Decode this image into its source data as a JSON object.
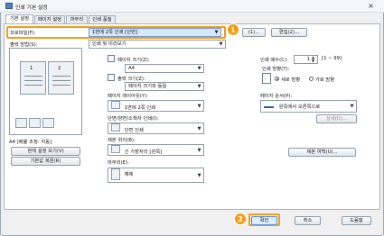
{
  "window": {
    "title": "인쇄 기본 설정",
    "close": "×"
  },
  "tabs": [
    "기본 설정",
    "페이지 설정",
    "마무리",
    "인쇄 품질"
  ],
  "profile": {
    "label": "프로파일(F):",
    "value": "1면에 2쪽 인쇄 [단면]",
    "add_label": "(1)...",
    "edit_label": "편집(2)..."
  },
  "output": {
    "label": "출력 방법(S):",
    "value": "인쇄 및 미리보기"
  },
  "preview": {
    "page1": "1",
    "page2": "2",
    "caption": "A4 [배율 조정: 자동]"
  },
  "left_buttons": {
    "view_settings": "현재 설정 보기(V)",
    "restore": "기본값 복원(R)"
  },
  "page_size": {
    "label": "페이지 크기(Z):",
    "value": "A4"
  },
  "output_size": {
    "label": "출력 크기(Z):",
    "value": "페이지 크기와 동일"
  },
  "layout": {
    "label": "페이지 레이아웃(Y):",
    "value": "1면에 2쪽 인쇄"
  },
  "duplex": {
    "label": "단면/양면/소책자 인쇄(I):",
    "value": "단면 인쇄"
  },
  "binding": {
    "label": "제본 위치(B):",
    "value": "긴 가장자리 [왼쪽]"
  },
  "finishing": {
    "label": "마무리(E):",
    "value": "해제"
  },
  "copies": {
    "label": "인쇄 매수(C):",
    "value": "1",
    "range": "[1 ~ 99]"
  },
  "orientation": {
    "label": "인쇄 방향(T):",
    "portrait": "세로 방향",
    "landscape": "가로 방향"
  },
  "page_order": {
    "label": "페이지 순서(P):",
    "value": "왼쪽에서 오른쪽으로",
    "button": "상세(D)..."
  },
  "binding_margin_button": "제본 여백(U)...",
  "footer": {
    "ok": "확인",
    "cancel": "취소",
    "help": "도움말"
  },
  "callouts": {
    "one": "1",
    "two": "2"
  }
}
